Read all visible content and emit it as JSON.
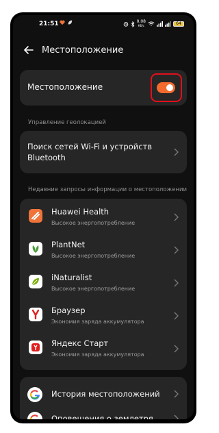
{
  "status_bar": {
    "time": "21:51",
    "network_speed_value": "0,08",
    "network_speed_unit": "КБ/с",
    "battery": "64"
  },
  "header": {
    "title": "Местоположение"
  },
  "location_toggle": {
    "label": "Местоположение",
    "enabled": true
  },
  "sections": {
    "geo_management": "Управление геолокацией",
    "recent_requests": "Недавние запросы информации о местоположении"
  },
  "wifi_bt_item": {
    "label": "Поиск сетей Wi-Fi и устройств Bluetooth"
  },
  "apps": [
    {
      "name": "Huawei Health",
      "usage": "Высокое энергопотребление",
      "icon": "huawei-health-icon",
      "color": "#f0743a"
    },
    {
      "name": "PlantNet",
      "usage": "Высокое энергопотребление",
      "icon": "plantnet-icon",
      "color": "#ffffff"
    },
    {
      "name": "iNaturalist",
      "usage": "Высокое энергопотребление",
      "icon": "inaturalist-icon",
      "color": "#ffffff"
    },
    {
      "name": "Браузер",
      "usage": "Экономия заряда аккумулятора",
      "icon": "yandex-browser-icon",
      "color": "#ffffff"
    },
    {
      "name": "Яндекс Старт",
      "usage": "Экономия заряда аккумулятора",
      "icon": "yandex-start-icon",
      "color": "#ffffff"
    }
  ],
  "google_items": [
    {
      "label": "История местоположений",
      "icon": "google-icon"
    },
    {
      "label": "Оповещения о землетря...",
      "icon": "google-icon"
    }
  ],
  "colors": {
    "background": "#101010",
    "card": "#262626",
    "accent": "#f26a2d",
    "highlight": "#e3101c"
  }
}
